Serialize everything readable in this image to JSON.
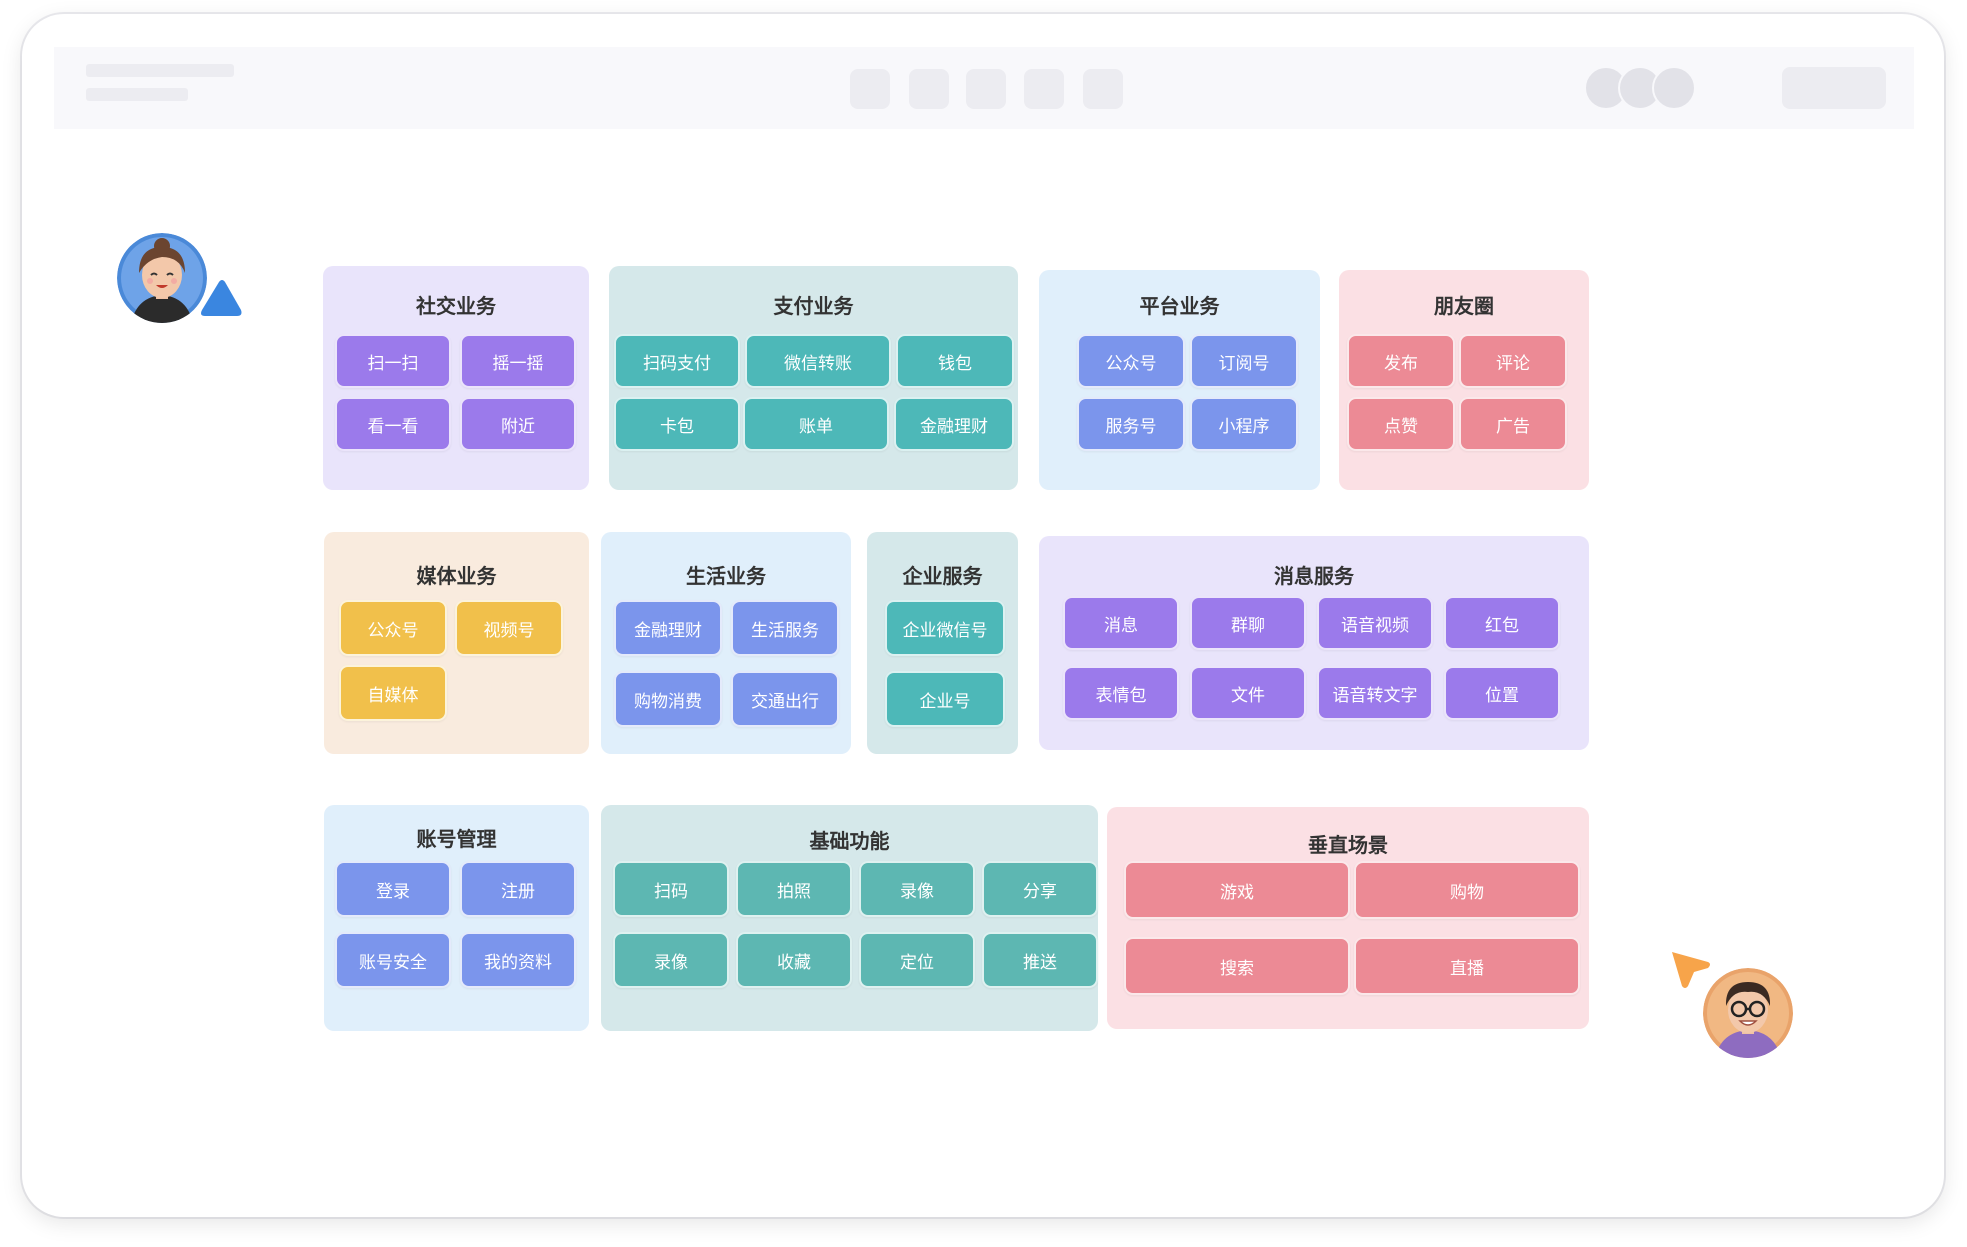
{
  "colors": {
    "social_bg": "#e9e4fb",
    "payment_bg": "#d5e8ea",
    "platform_bg": "#e0effb",
    "moments_bg": "#fbe0e4",
    "media_bg": "#f9ebde",
    "life_bg": "#e0effb",
    "enterprise_bg": "#d5e8ea",
    "message_bg": "#e9e4fb",
    "account_bg": "#e0effb",
    "basic_bg": "#d5e8ea",
    "vertical_bg": "#fbe0e4"
  },
  "icons": {
    "avatar_left": "woman-avatar-icon",
    "avatar_right": "man-glasses-avatar-icon",
    "cursor_blue": "cursor-pointer-icon",
    "cursor_orange": "cursor-pointer-icon"
  },
  "panels": {
    "social": {
      "title": "社交业务",
      "items": [
        "扫一扫",
        "摇一摇",
        "看一看",
        "附近"
      ]
    },
    "payment": {
      "title": "支付业务",
      "items": [
        "扫码支付",
        "微信转账",
        "钱包",
        "卡包",
        "账单",
        "金融理财"
      ]
    },
    "platform": {
      "title": "平台业务",
      "items": [
        "公众号",
        "订阅号",
        "服务号",
        "小程序"
      ]
    },
    "moments": {
      "title": "朋友圈",
      "items": [
        "发布",
        "评论",
        "点赞",
        "广告"
      ]
    },
    "media": {
      "title": "媒体业务",
      "items": [
        "公众号",
        "视频号",
        "自媒体"
      ]
    },
    "life": {
      "title": "生活业务",
      "items": [
        "金融理财",
        "生活服务",
        "购物消费",
        "交通出行"
      ]
    },
    "enterprise": {
      "title": "企业服务",
      "items": [
        "企业微信号",
        "企业号"
      ]
    },
    "message": {
      "title": "消息服务",
      "items": [
        "消息",
        "群聊",
        "语音视频",
        "红包",
        "表情包",
        "文件",
        "语音转文字",
        "位置"
      ]
    },
    "account": {
      "title": "账号管理",
      "items": [
        "登录",
        "注册",
        "账号安全",
        "我的资料"
      ]
    },
    "basic": {
      "title": "基础功能",
      "items": [
        "扫码",
        "拍照",
        "录像",
        "分享",
        "录像",
        "收藏",
        "定位",
        "推送"
      ]
    },
    "vertical": {
      "title": "垂直场景",
      "items": [
        "游戏",
        "购物",
        "搜索",
        "直播"
      ]
    }
  }
}
